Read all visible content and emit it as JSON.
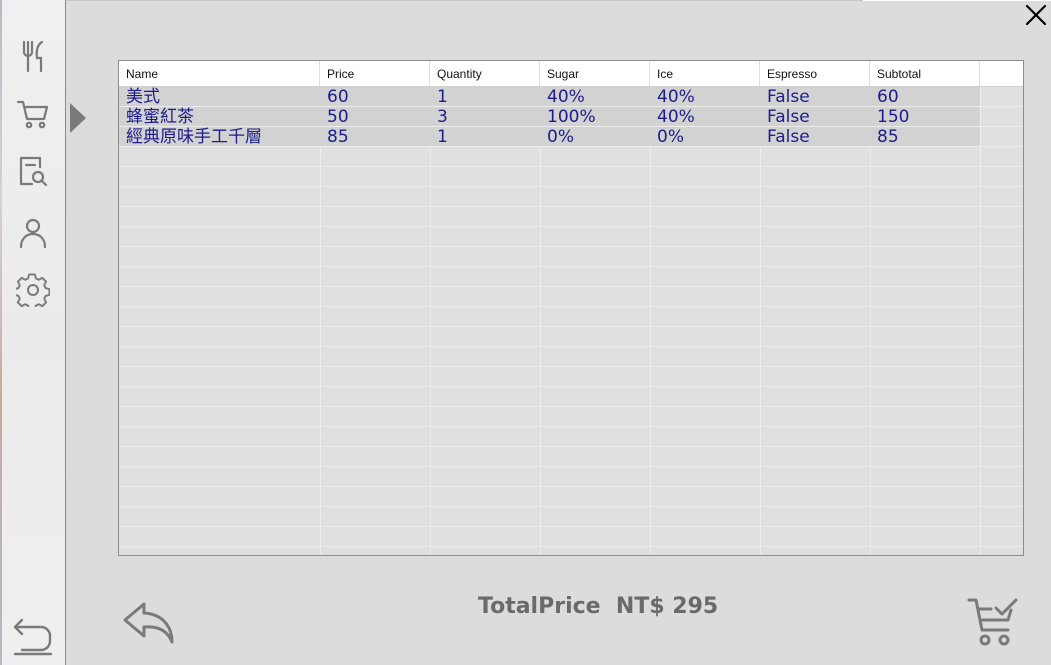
{
  "sidebar": {
    "items": [
      {
        "icon": "utensils-icon"
      },
      {
        "icon": "cart-icon"
      },
      {
        "icon": "order-search-icon"
      },
      {
        "icon": "user-icon"
      },
      {
        "icon": "gear-icon"
      }
    ],
    "active_index": 1,
    "logout_icon": "logout-arrow-icon"
  },
  "window": {
    "close_icon": "close-icon"
  },
  "order_table": {
    "columns": [
      "Name",
      "Price",
      "Quantity",
      "Sugar",
      "Ice",
      "Espresso",
      "Subtotal"
    ],
    "rows": [
      [
        "美式",
        "60",
        "1",
        "40%",
        "40%",
        "False",
        "60"
      ],
      [
        "蜂蜜紅茶",
        "50",
        "3",
        "100%",
        "40%",
        "False",
        "150"
      ],
      [
        "經典原味手工千層",
        "85",
        "1",
        "0%",
        "0%",
        "False",
        "85"
      ]
    ]
  },
  "footer": {
    "total_text": "TotalPrice  NT$ 295",
    "back_icon": "back-arrow-icon",
    "checkout_icon": "cart-check-icon"
  },
  "colors": {
    "row_text": "#1c1c8e",
    "total_text": "#6a6a6a",
    "icon": "#7a7a7a"
  }
}
